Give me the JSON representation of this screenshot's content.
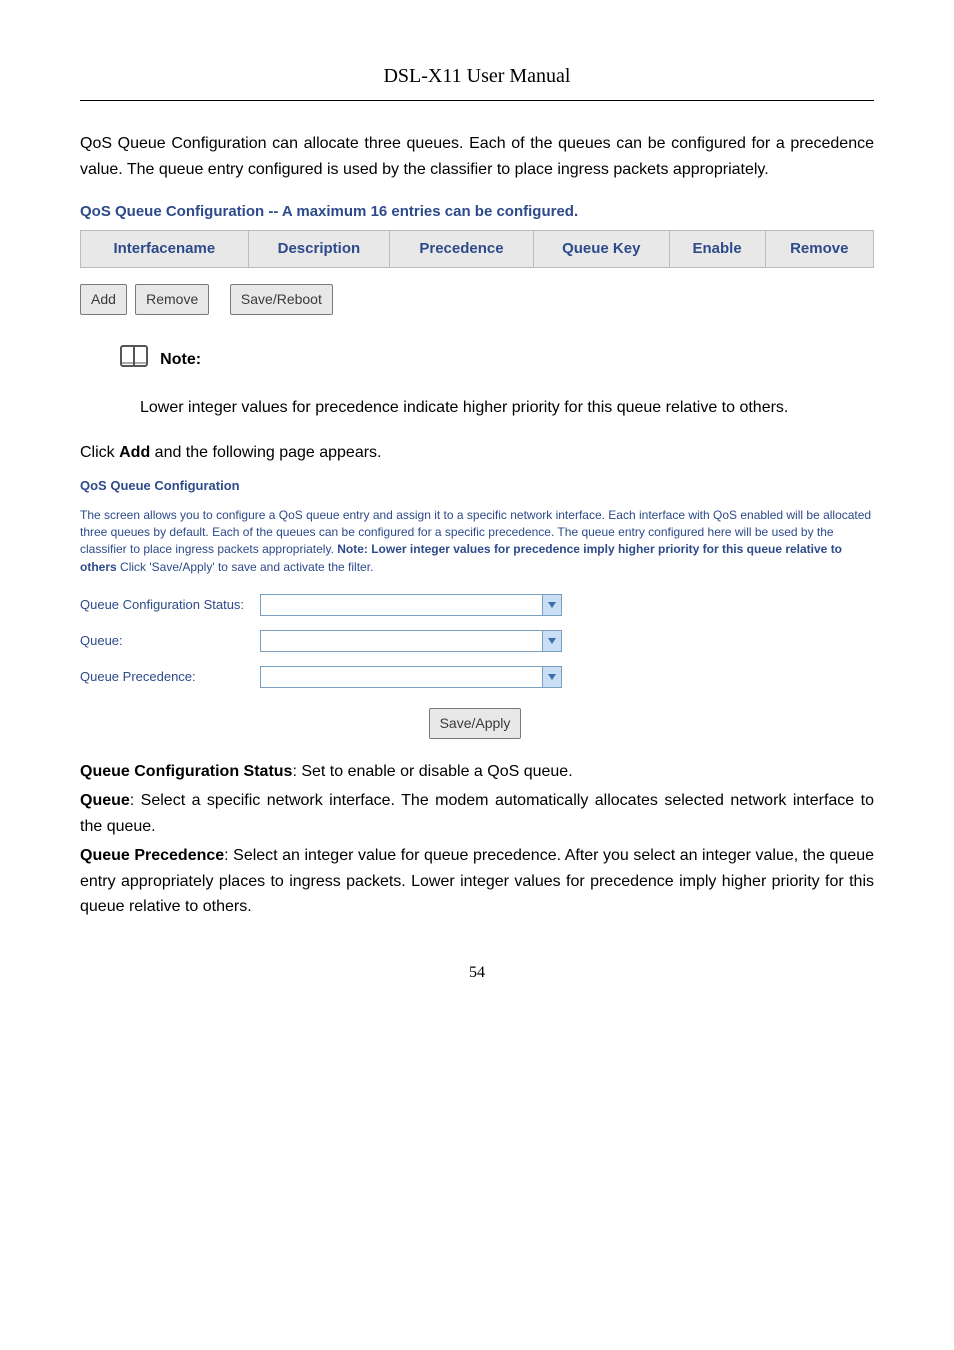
{
  "header": {
    "title": "DSL-X11 User Manual"
  },
  "intro": "QoS Queue Configuration can allocate three queues. Each of the queues can be configured for a precedence value. The queue entry configured is used by the classifier to place ingress packets appropriately.",
  "table": {
    "heading": "QoS Queue Configuration -- A maximum 16 entries can be configured.",
    "cols": [
      "Interfacename",
      "Description",
      "Precedence",
      "Queue Key",
      "Enable",
      "Remove"
    ]
  },
  "buttons": {
    "add": "Add",
    "remove": "Remove",
    "save_reboot": "Save/Reboot",
    "save_apply": "Save/Apply"
  },
  "note": {
    "label": "Note:",
    "text": "Lower integer values for precedence indicate higher priority for this queue relative to others."
  },
  "click_line": {
    "prefix": "Click ",
    "bold": "Add",
    "suffix": " and the following page appears."
  },
  "config": {
    "title": "QoS Queue Configuration",
    "desc_part1": "The screen allows you to configure a QoS queue entry and assign it to a specific network interface. Each interface with QoS enabled will be allocated three queues by default. Each of the queues can be configured for a specific precedence. The queue entry configured here will be used by the classifier to place ingress packets appropriately. ",
    "desc_bold1": "Note: Lower integer values for precedence imply higher priority for this queue relative to others",
    "desc_part2": " Click 'Save/Apply' to save and activate the filter.",
    "fields": {
      "status_label": "Queue Configuration Status:",
      "queue_label": "Queue:",
      "precedence_label": "Queue Precedence:"
    }
  },
  "definitions": {
    "d1_bold": "Queue Configuration Status",
    "d1_text": ": Set to enable or disable a QoS queue.",
    "d2_bold": "Queue",
    "d2_text": ": Select a specific network interface. The modem automatically allocates selected network interface to the queue.",
    "d3_bold": "Queue Precedence",
    "d3_text": ": Select an integer value for queue precedence. After you select an integer value, the queue entry appropriately places to ingress packets. Lower integer values for precedence imply higher priority for this queue relative to others."
  },
  "page_number": "54"
}
